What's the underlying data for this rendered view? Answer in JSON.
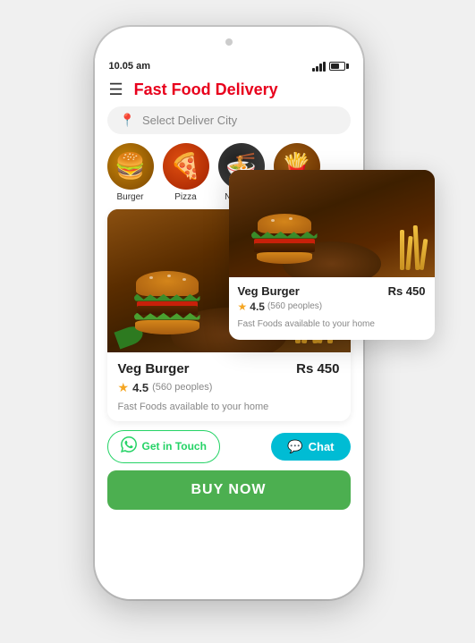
{
  "status_bar": {
    "time": "10.05 am",
    "signal": "signal",
    "battery": "battery"
  },
  "header": {
    "title": "Fast Food Delivery",
    "menu_icon": "hamburger-menu"
  },
  "search": {
    "placeholder": "Select Deliver City",
    "location_icon": "location-pin"
  },
  "categories": [
    {
      "id": "burger",
      "label": "Burger"
    },
    {
      "id": "pizza",
      "label": "Pizza"
    },
    {
      "id": "noodles",
      "label": "Noodles"
    },
    {
      "id": "fries",
      "label": "Fr..."
    }
  ],
  "food_card": {
    "name": "Veg Burger",
    "price": "Rs 450",
    "rating": "4.5",
    "rating_count": "(560 peoples)",
    "description": "Fast Foods available to your home",
    "image_alt": "veg-burger-image"
  },
  "floating_card": {
    "name": "Veg Burger",
    "price": "Rs 450",
    "rating": "4.5",
    "rating_count": "(560 peoples)",
    "description": "Fast Foods available to your home"
  },
  "actions": {
    "get_in_touch_label": "Get in Touch",
    "chat_label": "Chat",
    "buy_now_label": "BUY NOW"
  }
}
